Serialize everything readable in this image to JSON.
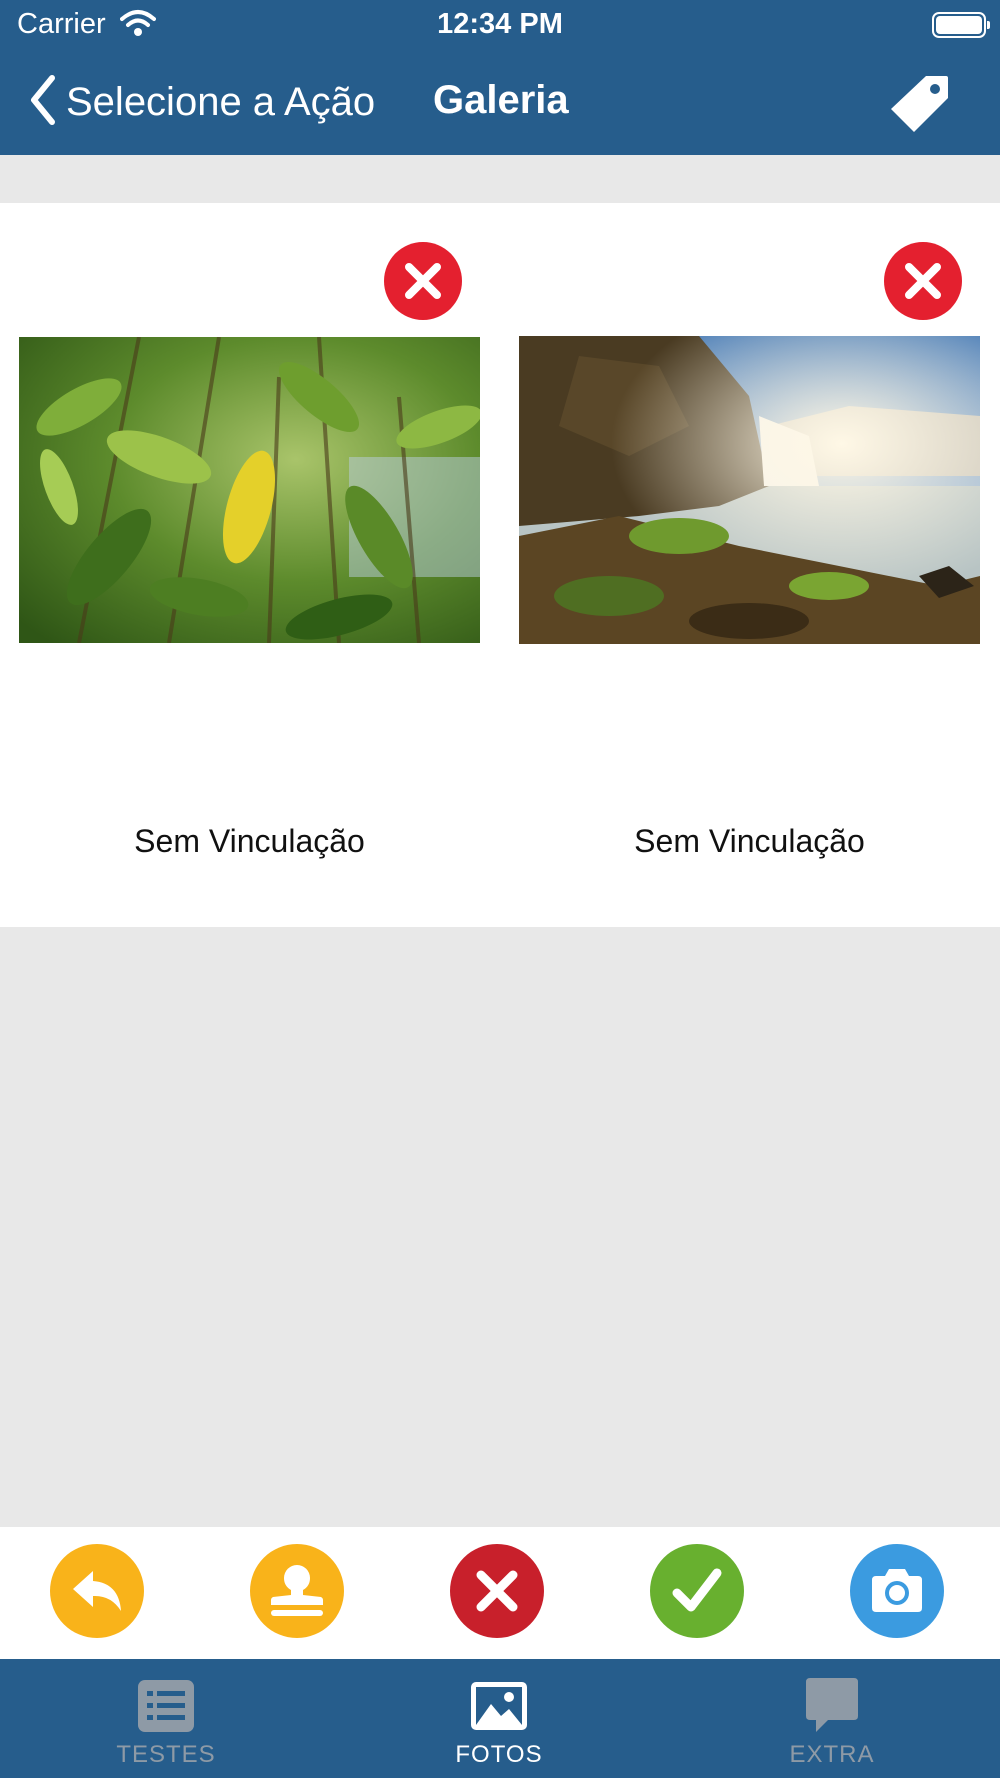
{
  "status_bar": {
    "carrier": "Carrier",
    "time": "12:34 PM"
  },
  "nav": {
    "back_label": "Selecione a Ação",
    "title": "Galeria"
  },
  "photos": [
    {
      "caption": "Sem Vinculação",
      "image": "leaves-photo"
    },
    {
      "caption": "Sem Vinculação",
      "image": "waterfall-photo"
    }
  ],
  "actions": [
    {
      "name": "reply",
      "icon": "reply-icon",
      "color": "#f9b31a"
    },
    {
      "name": "stamp",
      "icon": "stamp-icon",
      "color": "#f9b31a"
    },
    {
      "name": "reject",
      "icon": "close-icon",
      "color": "#c8202b"
    },
    {
      "name": "approve",
      "icon": "check-icon",
      "color": "#68b02f"
    },
    {
      "name": "camera",
      "icon": "camera-icon",
      "color": "#3b9be0"
    }
  ],
  "tabs": [
    {
      "label": "TESTES",
      "icon": "list-icon",
      "active": false
    },
    {
      "label": "FOTOS",
      "icon": "image-icon",
      "active": true
    },
    {
      "label": "EXTRA",
      "icon": "chat-bubble-icon",
      "active": false
    }
  ],
  "colors": {
    "header": "#265d8c",
    "remove": "#e4202f",
    "tab_active": "#ffffff",
    "tab_inactive": "#8e9aa6"
  }
}
